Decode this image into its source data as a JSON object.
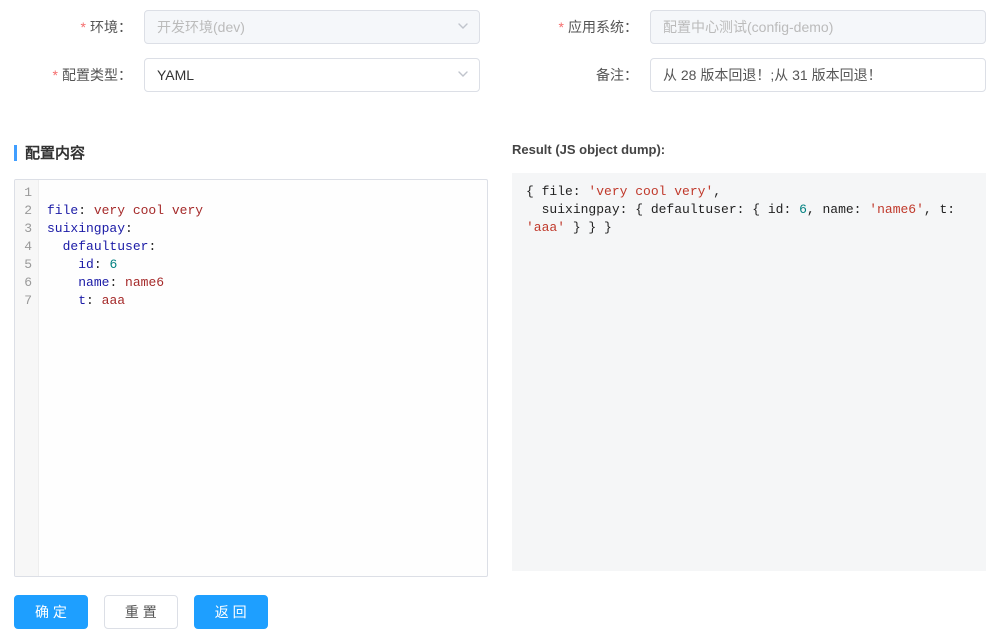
{
  "form": {
    "env": {
      "label": "环境：",
      "value": "开发环境(dev)"
    },
    "app": {
      "label": "应用系统：",
      "value": "配置中心测试(config-demo)"
    },
    "type": {
      "label": "配置类型：",
      "value": "YAML"
    },
    "remark": {
      "label": "备注：",
      "value": "从 28 版本回退！;从 31 版本回退！"
    }
  },
  "section": {
    "title": "配置内容"
  },
  "editor": {
    "lines": [
      {
        "n": "1",
        "indent": "",
        "key": "",
        "sep": "",
        "val": "",
        "klass": ""
      },
      {
        "n": "2",
        "indent": "",
        "key": "file",
        "sep": ": ",
        "val": "very cool very",
        "klass": "tok-val"
      },
      {
        "n": "3",
        "indent": "",
        "key": "suixingpay",
        "sep": ":",
        "val": "",
        "klass": ""
      },
      {
        "n": "4",
        "indent": "  ",
        "key": "defaultuser",
        "sep": ":",
        "val": "",
        "klass": ""
      },
      {
        "n": "5",
        "indent": "    ",
        "key": "id",
        "sep": ": ",
        "val": "6",
        "klass": "tok-num"
      },
      {
        "n": "6",
        "indent": "    ",
        "key": "name",
        "sep": ": ",
        "val": "name6",
        "klass": "tok-val"
      },
      {
        "n": "7",
        "indent": "    ",
        "key": "t",
        "sep": ": ",
        "val": "aaa",
        "klass": "tok-val"
      }
    ]
  },
  "result": {
    "label": "Result (JS object dump):",
    "tokens": [
      {
        "t": "{ file: ",
        "c": ""
      },
      {
        "t": "'very cool very'",
        "c": "str"
      },
      {
        "t": ",\n  suixingpay: { defaultuser: { id: ",
        "c": ""
      },
      {
        "t": "6",
        "c": "num"
      },
      {
        "t": ", name: ",
        "c": ""
      },
      {
        "t": "'name6'",
        "c": "str"
      },
      {
        "t": ", t: ",
        "c": ""
      },
      {
        "t": "'aaa'",
        "c": "str"
      },
      {
        "t": " } } }",
        "c": ""
      }
    ]
  },
  "buttons": {
    "ok": "确 定",
    "reset": "重 置",
    "back": "返 回"
  }
}
